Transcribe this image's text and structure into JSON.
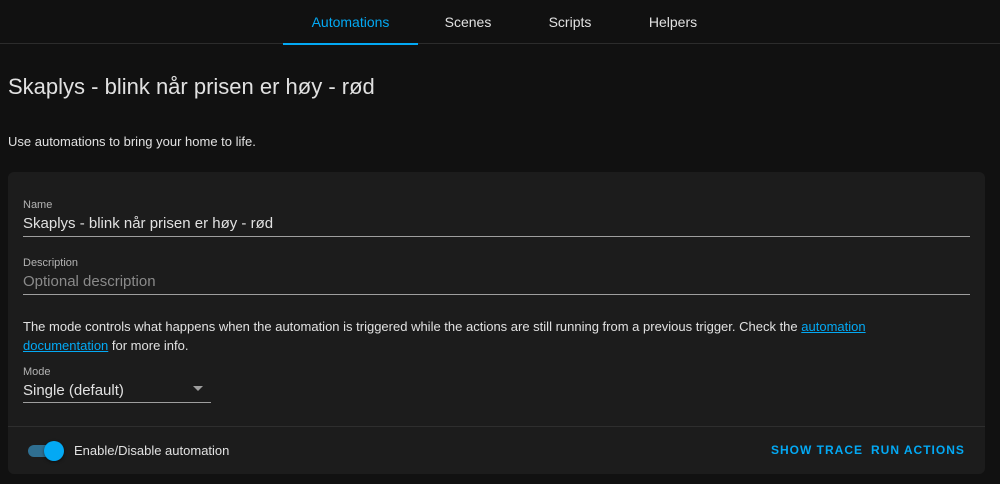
{
  "tabs": [
    {
      "label": "Automations",
      "active": true
    },
    {
      "label": "Scenes",
      "active": false
    },
    {
      "label": "Scripts",
      "active": false
    },
    {
      "label": "Helpers",
      "active": false
    }
  ],
  "page": {
    "title": "Skaplys - blink når prisen er høy - rød",
    "intro": "Use automations to bring your home to life."
  },
  "form": {
    "name": {
      "label": "Name",
      "value": "Skaplys - blink når prisen er høy - rød"
    },
    "description": {
      "label": "Description",
      "value": "",
      "placeholder": "Optional description"
    },
    "mode_info": {
      "text_before": "The mode controls what happens when the automation is triggered while the actions are still running from a previous trigger. Check the ",
      "link": "automation documentation",
      "text_after": " for more info."
    },
    "mode": {
      "label": "Mode",
      "value": "Single (default)"
    }
  },
  "footer": {
    "toggle_label": "Enable/Disable automation",
    "toggle_on": true,
    "show_trace": "Show trace",
    "run_actions": "Run actions"
  },
  "colors": {
    "accent": "#03a9f4",
    "background": "#111111",
    "card": "#1c1c1c",
    "text": "#e1e1e1"
  }
}
